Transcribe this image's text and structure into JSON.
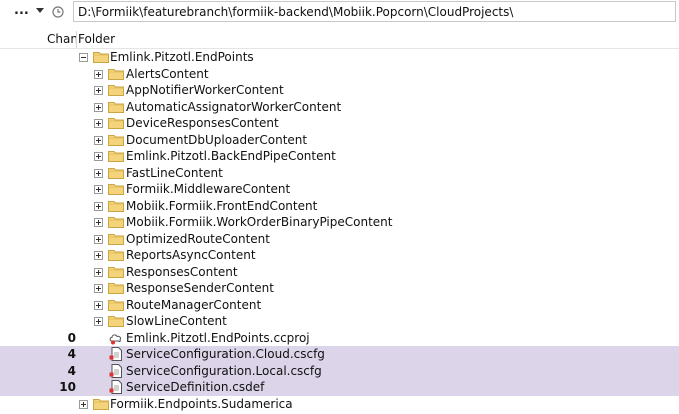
{
  "toolbar": {
    "more_label": "...",
    "dropdown_icon": "chevron-down-icon",
    "history_icon": "history-icon",
    "path": "D:\\Formiik\\featurebranch\\formiik-backend\\Mobiik.Popcorn\\CloudProjects\\"
  },
  "columns": {
    "changes": "Changes",
    "folder": "Folder"
  },
  "colors": {
    "selection": "#dcd4e8",
    "folder": "#f3d47a"
  },
  "tree": {
    "root": {
      "label": "Emlink.Pitzotl.EndPoints",
      "expanded": true
    },
    "folders": [
      "AlertsContent",
      "AppNotifierWorkerContent",
      "AutomaticAssignatorWorkerContent",
      "DeviceResponsesContent",
      "DocumentDbUploaderContent",
      "Emlink.Pitzotl.BackEndPipeContent",
      "FastLineContent",
      "Formiik.MiddlewareContent",
      "Mobiik.Formiik.FrontEndContent",
      "Mobiik.Formiik.WorkOrderBinaryPipeContent",
      "OptimizedRouteContent",
      "ReportsAsyncContent",
      "ResponsesContent",
      "ResponseSenderContent",
      "RouteManagerContent",
      "SlowLineContent"
    ],
    "files": [
      {
        "count": "0",
        "label": "Emlink.Pitzotl.EndPoints.ccproj",
        "icon": "cloud-project-icon",
        "selected": false
      },
      {
        "count": "4",
        "label": "ServiceConfiguration.Cloud.cscfg",
        "icon": "config-file-icon",
        "selected": true
      },
      {
        "count": "4",
        "label": "ServiceConfiguration.Local.cscfg",
        "icon": "config-file-icon",
        "selected": true
      },
      {
        "count": "10",
        "label": "ServiceDefinition.csdef",
        "icon": "definition-file-icon",
        "selected": true
      }
    ],
    "sibling": {
      "label": "Formiik.Endpoints.Sudamerica"
    }
  }
}
